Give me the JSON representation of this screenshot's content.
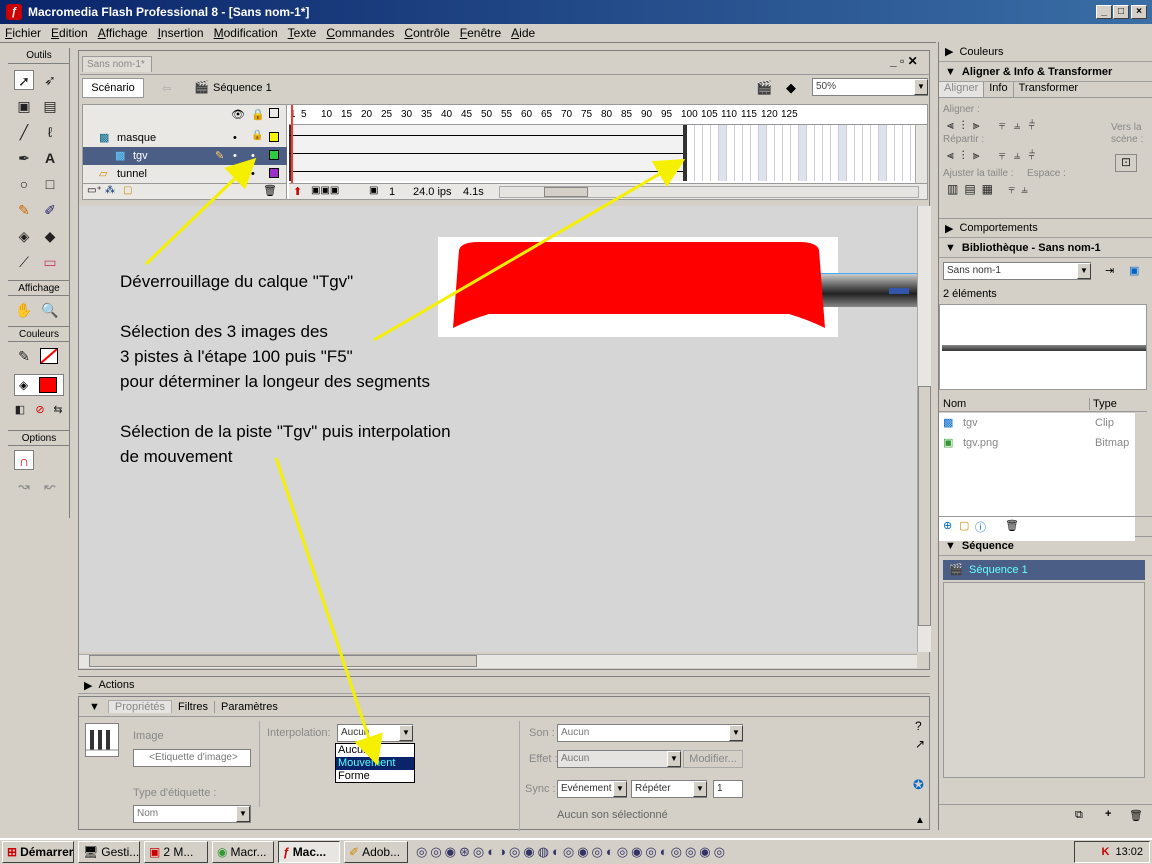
{
  "window": {
    "title": "Macromedia Flash Professional 8 - [Sans nom-1*]"
  },
  "menu": [
    "Fichier",
    "Edition",
    "Affichage",
    "Insertion",
    "Modification",
    "Texte",
    "Commandes",
    "Contrôle",
    "Fenêtre",
    "Aide"
  ],
  "tools": {
    "title": "Outils",
    "view_title": "Affichage",
    "colors_title": "Couleurs",
    "options_title": "Options"
  },
  "document": {
    "tab": "Sans nom-1*",
    "scene_button": "Scénario",
    "sequence": "Séquence 1",
    "zoom": "50%"
  },
  "timeline": {
    "frame_numbers": [
      "1",
      "5",
      "10",
      "15",
      "20",
      "25",
      "30",
      "35",
      "40",
      "45",
      "50",
      "55",
      "60",
      "65",
      "70",
      "75",
      "80",
      "85",
      "90",
      "95",
      "100",
      "105",
      "110",
      "115",
      "120",
      "125"
    ],
    "layers": [
      {
        "name": "masque",
        "color": "#f5f500"
      },
      {
        "name": "tgv",
        "color": "#2ecc40"
      },
      {
        "name": "tunnel",
        "color": "#9b30c8"
      }
    ],
    "current_frame": "1",
    "fps": "24.0 ips",
    "time": "4.1s"
  },
  "annotations": [
    "Déverrouillage du calque \"Tgv\"",
    "Sélection des 3 images des",
    "3 pistes à l'étape 100 puis \"F5\"",
    "pour déterminer la longeur des segments",
    "Sélection de la piste \"Tgv\" puis interpolation",
    "de mouvement"
  ],
  "actions_panel": "Actions",
  "properties": {
    "tabs": [
      "Propriétés",
      "Filtres",
      "Paramètres"
    ],
    "image_label": "Image",
    "frame_label_placeholder": "<Etiquette d'image>",
    "interpolation_label": "Interpolation:",
    "interpolation_value": "Aucun",
    "interpolation_options": [
      "Aucun",
      "Mouvement",
      "Forme"
    ],
    "label_type_label": "Type d'étiquette :",
    "label_type_value": "Nom",
    "sound_label": "Son :",
    "sound_value": "Aucun",
    "effect_label": "Effet :",
    "effect_value": "Aucun",
    "modify_button": "Modifier...",
    "sync_label": "Sync :",
    "sync_value": "Evénement",
    "repeat_value": "Répéter",
    "repeat_count": "1",
    "no_sound": "Aucun son sélectionné"
  },
  "right_panels": {
    "colors": "Couleurs",
    "align_title": "Aligner & Info & Transformer",
    "align_tabs": [
      "Aligner",
      "Info",
      "Transformer"
    ],
    "align_label": "Aligner :",
    "distribute_label": "Répartir :",
    "match_size_label": "Ajuster la taille :",
    "space_label": "Espace :",
    "to_stage": "Vers la scène :",
    "behaviors": "Comportements",
    "library_title": "Bibliothèque - Sans nom-1",
    "library_doc": "Sans nom-1",
    "library_count": "2 éléments",
    "library_columns": [
      "Nom",
      "Type"
    ],
    "library_items": [
      {
        "name": "tgv",
        "type": "Clip"
      },
      {
        "name": "tgv.png",
        "type": "Bitmap"
      }
    ],
    "sequence_title": "Séquence",
    "sequence_item": "Séquence 1"
  },
  "taskbar": {
    "start": "Démarrer",
    "items": [
      "Gesti...",
      "2 M...",
      "Macr...",
      "Mac...",
      "Adob..."
    ],
    "clock": "13:02"
  },
  "colors": {
    "stroke": "#000000",
    "fill": "#ff0000",
    "titlebar": "#0a246a"
  }
}
